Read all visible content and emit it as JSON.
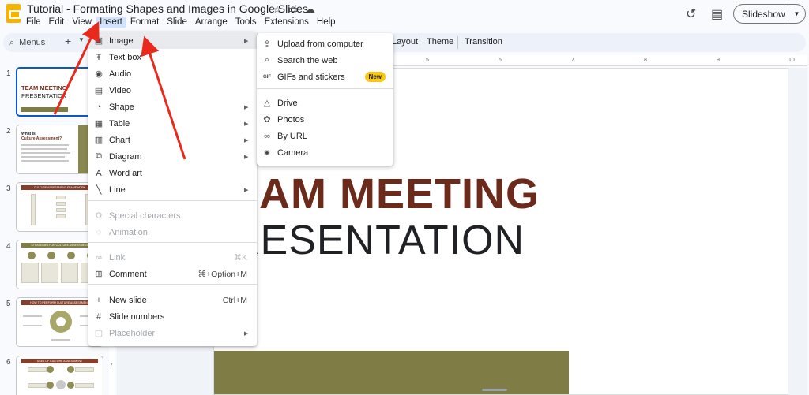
{
  "header": {
    "doc_title": "Tutorial - Formating Shapes and Images in Google Slides",
    "menus": [
      "File",
      "Edit",
      "View",
      "Insert",
      "Format",
      "Slide",
      "Arrange",
      "Tools",
      "Extensions",
      "Help"
    ],
    "active_menu": "Insert",
    "slideshow_label": "Slideshow"
  },
  "toolbar": {
    "search_placeholder": "Menus",
    "items": [
      "Layout",
      "Theme",
      "Transition"
    ]
  },
  "filmstrip": {
    "slides": [
      {
        "num": "1",
        "title": "TEAM MEETING",
        "subtitle": "PRESENTATION"
      },
      {
        "num": "2",
        "title": "What is",
        "subtitle": "Culture Assessment?"
      },
      {
        "num": "3",
        "title": "CULTURE ASSESSMENT FRAMEWORK"
      },
      {
        "num": "4",
        "title": "STRATEGIES FOR CULTURE ASSESSMENT"
      },
      {
        "num": "5",
        "title": "HOW TO PERFORM CULTURE ASSESSMENT"
      },
      {
        "num": "6",
        "title": "USES OF CULTURE ASSESSMENT"
      }
    ]
  },
  "ruler": {
    "labels": [
      "5",
      "6",
      "7",
      "8",
      "9",
      "10"
    ],
    "vlabel": "7"
  },
  "slide": {
    "title_text": "EAM MEETING",
    "subtitle_text": "RESENTATION",
    "accent_color": "#6b2a1a",
    "bar_color": "#7f7d45"
  },
  "insert_menu": {
    "items": [
      {
        "icon": "image-icon",
        "glyph": "▣",
        "label": "Image",
        "submenu": true,
        "highlighted": true
      },
      {
        "icon": "text-box-icon",
        "glyph": "Ŧ",
        "label": "Text box"
      },
      {
        "icon": "audio-icon",
        "glyph": "◉",
        "label": "Audio"
      },
      {
        "icon": "video-icon",
        "glyph": "▤",
        "label": "Video"
      },
      {
        "icon": "shape-icon",
        "glyph": "◔",
        "label": "Shape",
        "submenu": true
      },
      {
        "icon": "table-icon",
        "glyph": "▦",
        "label": "Table",
        "submenu": true
      },
      {
        "icon": "chart-icon",
        "glyph": "▥",
        "label": "Chart",
        "submenu": true
      },
      {
        "icon": "diagram-icon",
        "glyph": "⧉",
        "label": "Diagram",
        "submenu": true
      },
      {
        "icon": "word-art-icon",
        "glyph": "A",
        "label": "Word art"
      },
      {
        "icon": "line-icon",
        "glyph": "╲",
        "label": "Line",
        "submenu": true
      },
      {
        "icon": "special-characters-icon",
        "glyph": "Ω",
        "label": "Special characters",
        "disabled": true
      },
      {
        "icon": "animation-icon",
        "glyph": "◌",
        "label": "Animation",
        "disabled": true
      },
      {
        "icon": "link-icon",
        "glyph": "∞",
        "label": "Link",
        "shortcut": "⌘K",
        "disabled": true
      },
      {
        "icon": "comment-icon",
        "glyph": "⊞",
        "label": "Comment",
        "shortcut": "⌘+Option+M"
      },
      {
        "icon": "new-slide-icon",
        "glyph": "+",
        "label": "New slide",
        "shortcut": "Ctrl+M"
      },
      {
        "icon": "slide-numbers-icon",
        "glyph": "#",
        "label": "Slide numbers"
      },
      {
        "icon": "placeholder-icon",
        "glyph": "▢",
        "label": "Placeholder",
        "submenu": true,
        "disabled": true
      }
    ]
  },
  "image_submenu": {
    "items": [
      {
        "icon": "upload-icon",
        "glyph": "⇪",
        "label": "Upload from computer"
      },
      {
        "icon": "search-icon",
        "glyph": "⌕",
        "label": "Search the web"
      },
      {
        "icon": "gif-icon",
        "glyph": "GIF",
        "label": "GIFs and stickers",
        "badge": "New"
      },
      {
        "icon": "drive-icon",
        "glyph": "△",
        "label": "Drive"
      },
      {
        "icon": "photos-icon",
        "glyph": "✿",
        "label": "Photos"
      },
      {
        "icon": "link-icon",
        "glyph": "∞",
        "label": "By URL"
      },
      {
        "icon": "camera-icon",
        "glyph": "◙",
        "label": "Camera"
      }
    ]
  },
  "annotation": {
    "arrow_color": "#e8291c"
  }
}
